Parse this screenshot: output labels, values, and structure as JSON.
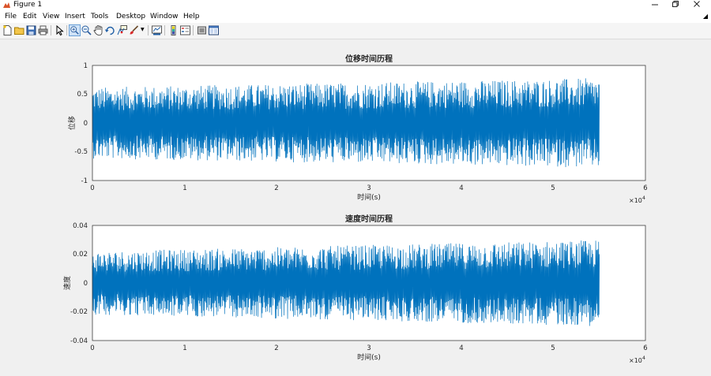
{
  "window": {
    "title": "Figure 1",
    "minimize_icon": "minimize-icon",
    "maximize_icon": "restore-icon",
    "close_icon": "close-icon"
  },
  "menu": [
    "File",
    "Edit",
    "View",
    "Insert",
    "Tools",
    "Desktop",
    "Window",
    "Help"
  ],
  "toolbar": [
    "new-figure-icon",
    "open-file-icon",
    "save-icon",
    "print-icon",
    "edit-plot-icon",
    "zoom-in-icon",
    "zoom-out-icon",
    "pan-icon",
    "rotate-3d-icon",
    "data-cursor-icon",
    "brush-icon",
    "brush-dropdown-icon",
    "link-plot-icon",
    "insert-colorbar-icon",
    "insert-legend-icon",
    "hide-plot-tools-icon",
    "show-plot-tools-icon"
  ],
  "chart_data": [
    {
      "type": "line",
      "title": "位移时间历程",
      "xlabel": "时间(s)",
      "ylabel": "位移",
      "xlim": [
        0,
        60000
      ],
      "ylim": [
        -1,
        1
      ],
      "xticks": [
        "0",
        "1",
        "2",
        "3",
        "4",
        "5",
        "6"
      ],
      "yticks": [
        "1",
        "0.5",
        "0",
        "-0.5",
        "-1"
      ],
      "x_multiplier": "×10",
      "x_exponent": "4",
      "series": [
        {
          "color": "#0072BD",
          "x_range": [
            0,
            55000
          ],
          "envelope_start": 0.62,
          "envelope_end": 0.78,
          "mean": 0
        }
      ]
    },
    {
      "type": "line",
      "title": "速度时间历程",
      "xlabel": "时间(s)",
      "ylabel": "速度",
      "xlim": [
        0,
        60000
      ],
      "ylim": [
        -0.04,
        0.04
      ],
      "xticks": [
        "0",
        "1",
        "2",
        "3",
        "4",
        "5",
        "6"
      ],
      "yticks": [
        "0.04",
        "0.02",
        "0",
        "-0.02",
        "-0.04"
      ],
      "x_multiplier": "×10",
      "x_exponent": "4",
      "series": [
        {
          "color": "#0072BD",
          "x_range": [
            0,
            55000
          ],
          "envelope_start": 0.022,
          "envelope_end": 0.03,
          "mean": 0
        }
      ]
    }
  ]
}
